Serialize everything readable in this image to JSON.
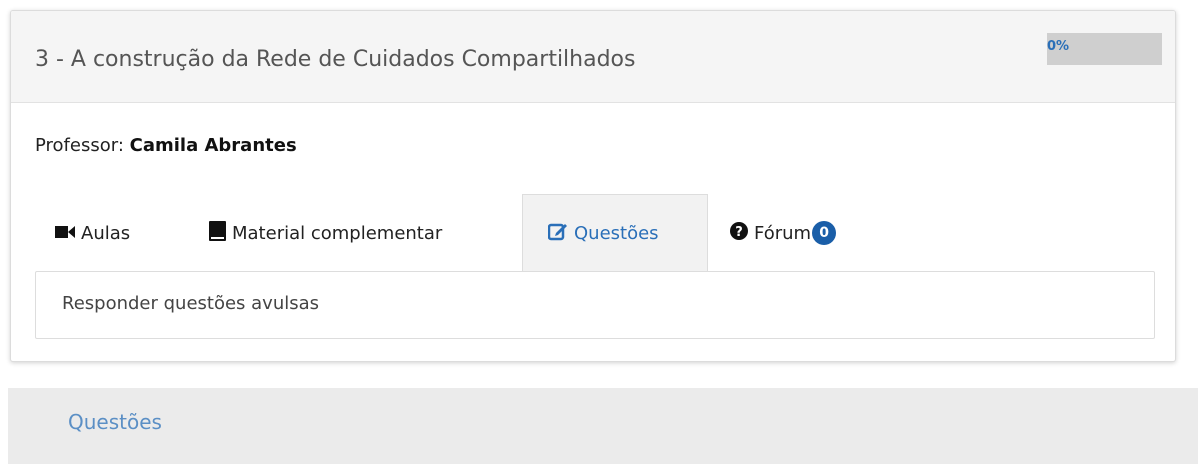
{
  "module": {
    "title": "3 - A construção da Rede de Cuidados Compartilhados",
    "progress": {
      "value": 0,
      "label": "0%",
      "color": "#2a7fd4"
    },
    "professor_label": "Professor:",
    "professor_name": "Camila Abrantes"
  },
  "tabs": [
    {
      "label": "Aulas",
      "icon": "video-camera-icon",
      "active": false
    },
    {
      "label": "Material complementar",
      "icon": "book-icon",
      "active": false
    },
    {
      "label": "Questões",
      "icon": "edit-square-icon",
      "active": true
    },
    {
      "label": "Fórum",
      "icon": "question-circle-icon",
      "active": false,
      "badge": "0"
    }
  ],
  "tab_content": {
    "text": "Responder questões avulsas"
  },
  "section": {
    "title": "Questões"
  },
  "colors": {
    "accent": "#2a6fb8",
    "badge": "#1a5ea8",
    "header_bg": "#f5f5f5"
  }
}
